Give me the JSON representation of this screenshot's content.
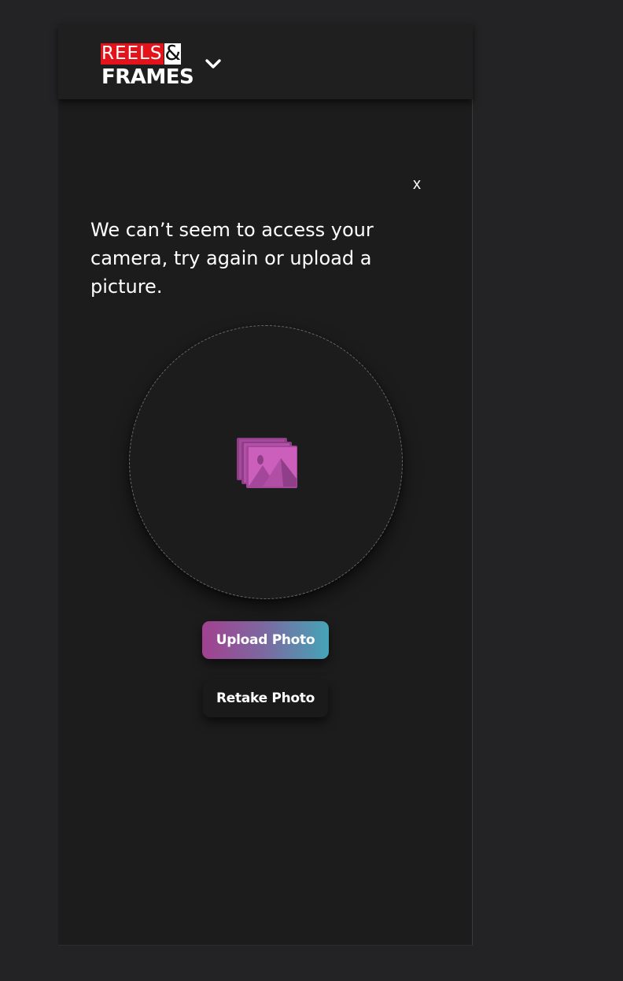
{
  "header": {
    "logo": {
      "reels": "REELS",
      "ampersand": "&",
      "frames": "FRAMES"
    },
    "menu_icon": "chevron-down-icon"
  },
  "dialog": {
    "close_label": "x",
    "message": "We can’t seem to access your camera, try again or upload a picture.",
    "photo_placeholder_icon": "gallery-icon",
    "upload_button_label": "Upload Photo",
    "retake_button_label": "Retake Photo"
  },
  "colors": {
    "background": "#232325",
    "panel": "#1c1c1c",
    "logo_red": "#e3131b",
    "upload_gradient_start": "#a2418f",
    "upload_gradient_end": "#45a4b7",
    "icon_magenta": "#c957ba"
  }
}
